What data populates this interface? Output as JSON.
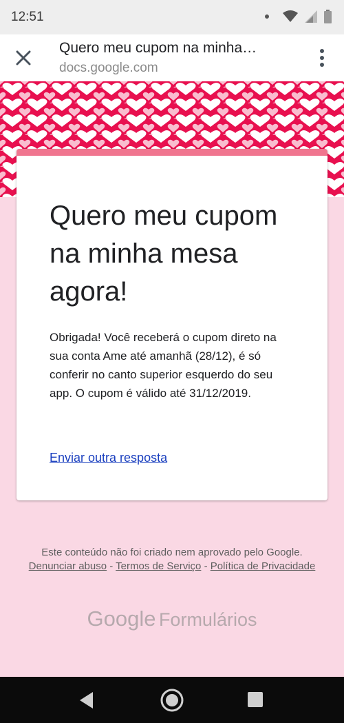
{
  "status_bar": {
    "time": "12:51"
  },
  "browser": {
    "title": "Quero meu cupom na minha…",
    "url": "docs.google.com",
    "close_icon": "close-icon",
    "menu_icon": "more-vert-icon"
  },
  "form": {
    "title": "Quero meu cupom na minha mesa agora!",
    "message": "Obrigada! Você receberá o cupom direto na sua conta Ame até amanhã (28/12), é só conferir no canto superior esquerdo do seu app. O cupom é válido até 31/12/2019.",
    "another_response_link": "Enviar outra resposta",
    "accent_color": "#e8104f",
    "background_color": "#fad8e4"
  },
  "footer": {
    "disclaimer_text": "Este conteúdo não foi criado nem aprovado pelo Google.",
    "report_abuse": "Denunciar abuso",
    "separator1": "-",
    "terms": "Termos de Serviço",
    "separator2": "-",
    "privacy": "Política de Privacidade",
    "brand_google": "Google",
    "brand_forms": "Formulários"
  }
}
